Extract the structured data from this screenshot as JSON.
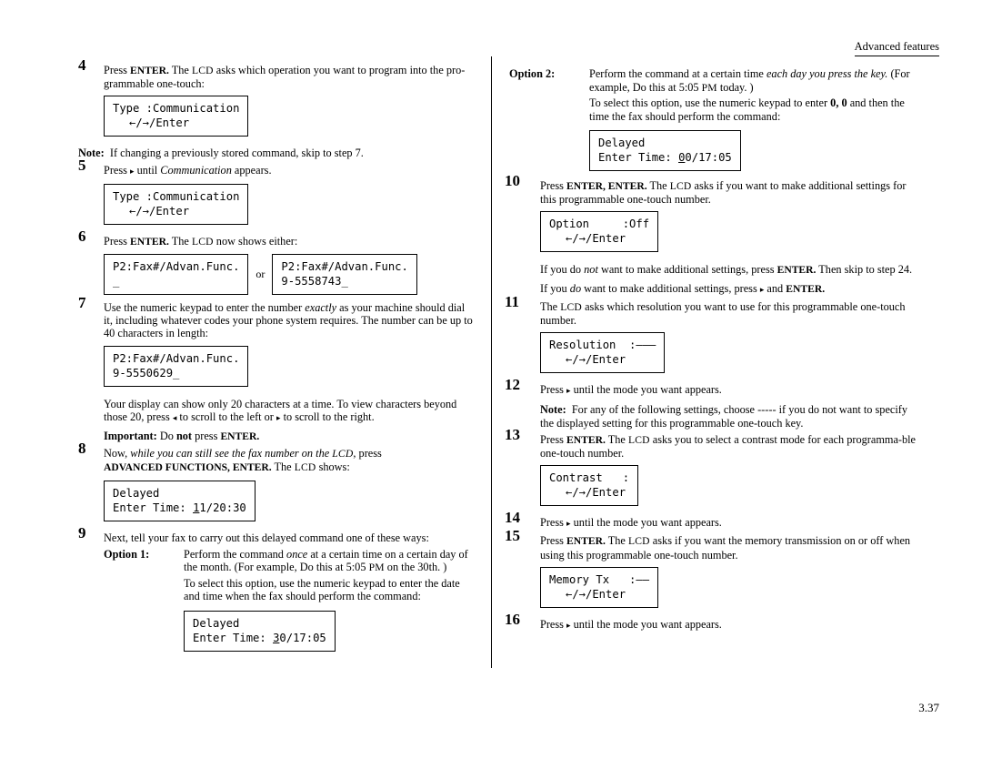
{
  "header": {
    "title": "Advanced features"
  },
  "footer": {
    "page": "3.37"
  },
  "left": {
    "step4": {
      "num": "4",
      "text_1": "Press ",
      "enter": "ENTER.",
      "text_2": " The ",
      "lcd": "LCD",
      "text_3": " asks which operation you want to program into the pro-grammable one-touch:",
      "display_line1": "Type :Communication",
      "display_line2": "←/→/Enter"
    },
    "note1": {
      "label": "Note:",
      "text": "If changing a previously stored command, skip to step 7."
    },
    "step5": {
      "num": "5",
      "text_1": "Press ",
      "arrow": "▸",
      "text_2": " until ",
      "italic": "Communication",
      "text_3": " appears.",
      "display_line1": "Type :Communication",
      "display_line2": "←/→/Enter"
    },
    "step6": {
      "num": "6",
      "text_1": "Press ",
      "enter": "ENTER.",
      "text_2": " The ",
      "lcd": "LCD",
      "text_3": " now shows either:",
      "display_a_line1": "P2:Fax#/Advan.Func.",
      "display_a_line2": "_",
      "or": "or",
      "display_b_line1": "P2:Fax#/Advan.Func.",
      "display_b_line2": "9-5558743_"
    },
    "step7": {
      "num": "7",
      "text_1": "Use the numeric keypad to enter the number ",
      "italic": "exactly",
      "text_2": " as your machine should dial it, including whatever codes your phone system requires. The number can be up to 40 characters in length:",
      "display_line1": "P2:Fax#/Advan.Func.",
      "display_line2": "9-5550629_",
      "after_1": "Your display can show only 20 characters at a time. To view characters beyond those 20, press ",
      "arrow_left": "◂",
      "after_2": " to scroll to the left or ",
      "arrow_right": "▸",
      "after_3": " to scroll to the right.",
      "important_label": "Important:",
      "important_text_1": " Do ",
      "important_not": "not",
      "important_text_2": " press ",
      "important_enter": "ENTER."
    },
    "step8": {
      "num": "8",
      "text_1": "Now, ",
      "italic": "while you can still see the fax number on the ",
      "lcd_i": "LCD",
      "text_2": ", press ",
      "adv": "ADVANCED FUNCTIONS, ENTER.",
      "text_3": " The ",
      "lcd": "LCD",
      "text_4": " shows:",
      "display_line1": "Delayed",
      "display_line2_pre": "Enter Time: ",
      "display_line2_u": "1",
      "display_line2_post": "1/20:30"
    },
    "step9": {
      "num": "9",
      "text": "Next, tell your fax to carry out this delayed command one of these ways:",
      "option1_label": "Option 1:",
      "option1_text_1": "Perform the command ",
      "option1_italic": "once",
      "option1_text_2": " at a certain time on a certain day of the month. (For example, Do this at 5:05 ",
      "option1_pm": "PM",
      "option1_text_3": " on the 30th. )",
      "option1_text_4": "To select this option, use the numeric keypad to enter the date and time when the fax should perform the command:",
      "display_line1": "Delayed",
      "display_line2_pre": "Enter Time: ",
      "display_line2_u": "3",
      "display_line2_post": "0/17:05"
    }
  },
  "right": {
    "option2": {
      "label": "Option 2:",
      "text_1": "Perform the command at a certain time ",
      "italic_1": "each day you press the key.",
      "text_2": " (For example, Do this at 5:05 ",
      "pm": "PM",
      "text_3": " today. )",
      "text_4": "To select this option, use the numeric keypad to enter ",
      "bold_0": "0, 0",
      "text_5": " and then the time the fax should perform the command:",
      "display_line1": "Delayed",
      "display_line2_pre": "Enter Time: ",
      "display_line2_u": "0",
      "display_line2_post": "0/17:05"
    },
    "step10": {
      "num": "10",
      "text_1": "Press ",
      "enter1": "ENTER, ENTER.",
      "text_2": " The ",
      "lcd": "LCD",
      "text_3": " asks if you want to make additional settings for this programmable one-touch number.",
      "display_line1": "Option     :Off",
      "display_line2": "←/→/Enter",
      "after_1": "If you do ",
      "after_italic": "not",
      "after_2": " want to make additional settings, press ",
      "after_enter": "ENTER.",
      "after_3": " Then skip to step 24.",
      "after2_1": "If you ",
      "after2_italic": "do",
      "after2_2": " want to make additional settings, press ",
      "after2_arrow": "▸",
      "after2_3": " and ",
      "after2_enter": "ENTER."
    },
    "step11": {
      "num": "11",
      "text_1": "The ",
      "lcd": "LCD",
      "text_2": " asks which resolution you want to use for this programmable one-touch number.",
      "display_line1": "Resolution  :———",
      "display_line2": "←/→/Enter"
    },
    "step12": {
      "num": "12",
      "text_1": "Press ",
      "arrow": "▸",
      "text_2": " until the mode you want appears.",
      "note_label": "Note:",
      "note_text": "For any of the following settings, choose  -----  if you do not want to specify the displayed setting for this programmable one-touch key."
    },
    "step13": {
      "num": "13",
      "text_1": "Press ",
      "enter": "ENTER.",
      "text_2": " The ",
      "lcd": "LCD",
      "text_3": " asks you to select a contrast mode for each programma-ble one-touch number.",
      "display_line1": "Contrast   :",
      "display_line2": "←/→/Enter"
    },
    "step14": {
      "num": "14",
      "text_1": "Press ",
      "arrow": "▸",
      "text_2": " until the mode you want appears."
    },
    "step15": {
      "num": "15",
      "text_1": "Press ",
      "enter": "ENTER.",
      "text_2": " The ",
      "lcd": "LCD",
      "text_3": " asks if you want the memory transmission on or off when using this programmable one-touch number.",
      "display_line1": "Memory Tx   :——",
      "display_line2": "←/→/Enter"
    },
    "step16": {
      "num": "16",
      "text_1": "Press ",
      "arrow": "▸",
      "text_2": " until the mode you want appears."
    }
  }
}
